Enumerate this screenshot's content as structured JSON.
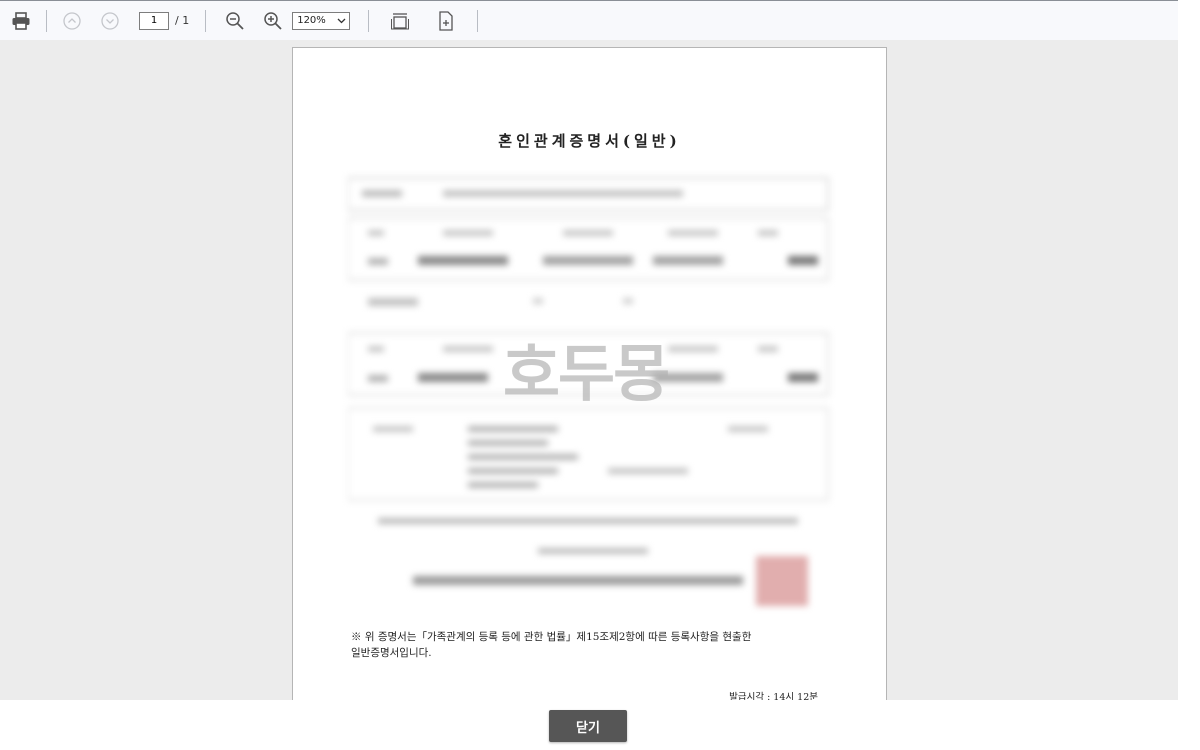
{
  "toolbar": {
    "page_current": "1",
    "page_total": "/ 1",
    "zoom_value": "120%",
    "icons": [
      "print-icon",
      "previous-page-icon",
      "next-page-icon",
      "zoom-out-icon",
      "zoom-in-icon",
      "fit-width-icon",
      "fit-page-icon",
      "chevron-down-icon"
    ]
  },
  "document": {
    "title": "혼인관계증명서(일반)",
    "watermark": "호두몽",
    "notice_line1": "※ 위 증명서는「가족관계의 등록 등에 관한 법률」제15조제2항에 따른 등록사항을 현출한",
    "notice_line2": "일반증명서입니다.",
    "issue_time": "발급시각 : 14시 12분"
  },
  "footer": {
    "close_label": "닫기"
  },
  "colors": {
    "toolbar_bg": "#f8f9fc",
    "viewer_bg": "#ececec",
    "close_button_bg": "#565656",
    "seal": "#d99a9a"
  }
}
